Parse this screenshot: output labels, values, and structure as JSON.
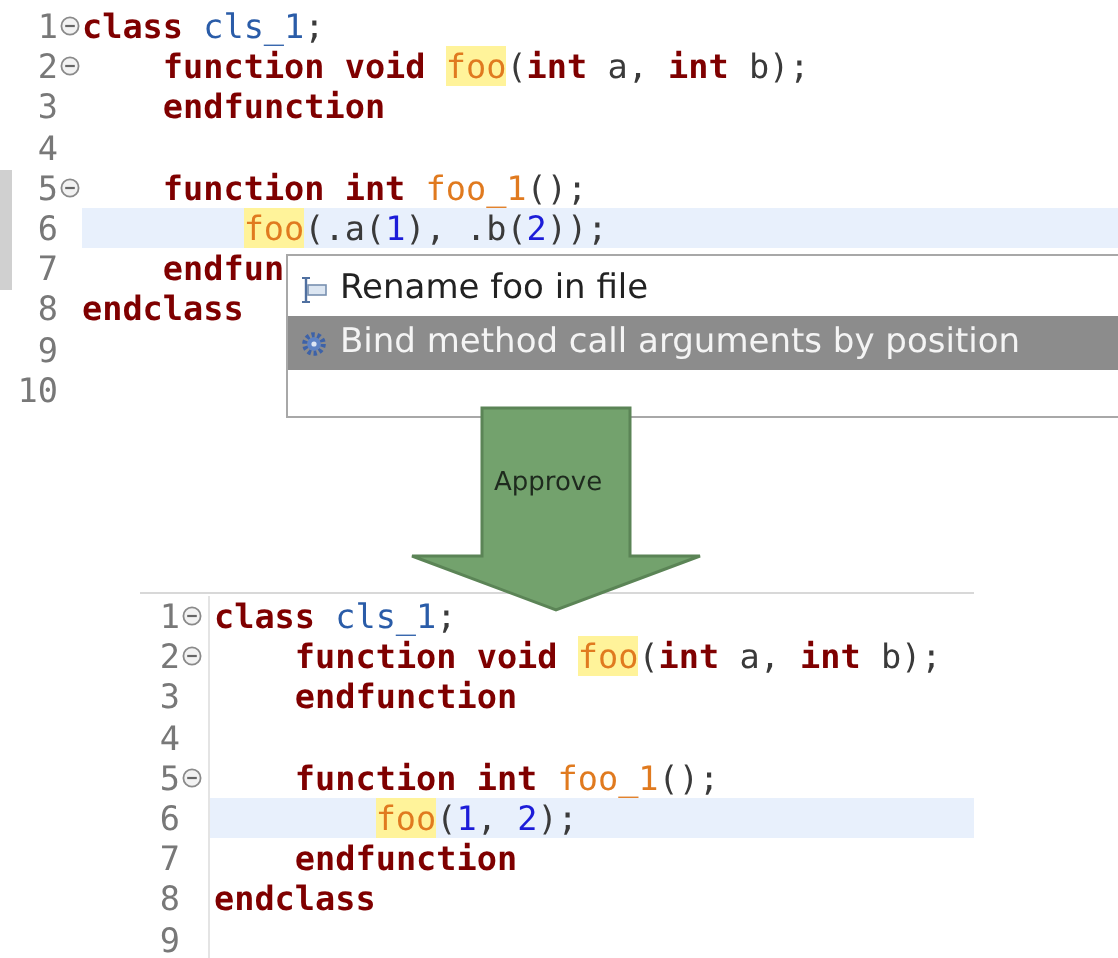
{
  "editors": [
    {
      "lines": [
        {
          "number": "1",
          "fold": true,
          "current": false,
          "tokens": [
            {
              "text": "class ",
              "kind": "keyword"
            },
            {
              "text": "cls_1",
              "kind": "type"
            },
            {
              "text": ";",
              "kind": "plain"
            }
          ]
        },
        {
          "number": "2",
          "fold": true,
          "current": false,
          "tokens": [
            {
              "text": "    function void ",
              "kind": "keyword"
            },
            {
              "text": "foo",
              "kind": "occurrence"
            },
            {
              "text": "(",
              "kind": "plain"
            },
            {
              "text": "int ",
              "kind": "keyword"
            },
            {
              "text": "a, ",
              "kind": "plain"
            },
            {
              "text": "int ",
              "kind": "keyword"
            },
            {
              "text": "b);",
              "kind": "plain"
            }
          ]
        },
        {
          "number": "3",
          "fold": false,
          "current": false,
          "tokens": [
            {
              "text": "    endfunction",
              "kind": "keyword"
            }
          ]
        },
        {
          "number": "4",
          "fold": false,
          "current": false
        },
        {
          "number": "5",
          "fold": true,
          "current": false,
          "tokens": [
            {
              "text": "    function int ",
              "kind": "keyword"
            },
            {
              "text": "foo_1",
              "kind": "function"
            },
            {
              "text": "();",
              "kind": "plain"
            }
          ]
        },
        {
          "number": "6",
          "fold": false,
          "current": true,
          "tokens": [
            {
              "text": "        foo",
              "kind": "occurrence"
            },
            {
              "text": "(.a(",
              "kind": "plain"
            },
            {
              "text": "1",
              "kind": "number"
            },
            {
              "text": "), .b(",
              "kind": "plain"
            },
            {
              "text": "2",
              "kind": "number"
            },
            {
              "text": "));",
              "kind": "plain"
            }
          ]
        },
        {
          "number": "7",
          "fold": false,
          "current": false,
          "tokens": [
            {
              "text": "    endfun",
              "kind": "keyword"
            }
          ]
        },
        {
          "number": "8",
          "fold": false,
          "current": false,
          "tokens": [
            {
              "text": "endclass",
              "kind": "keyword"
            }
          ]
        },
        {
          "number": "9",
          "fold": false,
          "current": false
        },
        {
          "number": "10",
          "fold": false,
          "current": false
        }
      ]
    },
    {
      "lines": [
        {
          "number": "1",
          "fold": true,
          "current": false,
          "tokens": [
            {
              "text": "class ",
              "kind": "keyword"
            },
            {
              "text": "cls_1",
              "kind": "type"
            },
            {
              "text": ";",
              "kind": "plain"
            }
          ]
        },
        {
          "number": "2",
          "fold": true,
          "current": false,
          "tokens": [
            {
              "text": "    function void ",
              "kind": "keyword"
            },
            {
              "text": "foo",
              "kind": "occurrence"
            },
            {
              "text": "(",
              "kind": "plain"
            },
            {
              "text": "int ",
              "kind": "keyword"
            },
            {
              "text": "a, ",
              "kind": "plain"
            },
            {
              "text": "int ",
              "kind": "keyword"
            },
            {
              "text": "b);",
              "kind": "plain"
            }
          ]
        },
        {
          "number": "3",
          "fold": false,
          "current": false,
          "tokens": [
            {
              "text": "    endfunction",
              "kind": "keyword"
            }
          ]
        },
        {
          "number": "4",
          "fold": false,
          "current": false
        },
        {
          "number": "5",
          "fold": true,
          "current": false,
          "tokens": [
            {
              "text": "    function int ",
              "kind": "keyword"
            },
            {
              "text": "foo_1",
              "kind": "function"
            },
            {
              "text": "();",
              "kind": "plain"
            }
          ]
        },
        {
          "number": "6",
          "fold": false,
          "current": true,
          "tokens": [
            {
              "text": "        foo",
              "kind": "occurrence"
            },
            {
              "text": "(",
              "kind": "plain"
            },
            {
              "text": "1",
              "kind": "number"
            },
            {
              "text": ", ",
              "kind": "plain"
            },
            {
              "text": "2",
              "kind": "number"
            },
            {
              "text": ");",
              "kind": "plain"
            }
          ]
        },
        {
          "number": "7",
          "fold": false,
          "current": false,
          "tokens": [
            {
              "text": "    endfunction",
              "kind": "keyword"
            }
          ]
        },
        {
          "number": "8",
          "fold": false,
          "current": false,
          "tokens": [
            {
              "text": "endclass",
              "kind": "keyword"
            }
          ]
        },
        {
          "number": "9",
          "fold": false,
          "current": false
        }
      ]
    }
  ],
  "popup": {
    "items": [
      {
        "label": "Rename foo in file",
        "kind": "rename",
        "selected": false
      },
      {
        "label": "Bind method call arguments by position",
        "kind": "gear",
        "selected": true
      }
    ]
  },
  "arrow": {
    "label": "Approve"
  }
}
